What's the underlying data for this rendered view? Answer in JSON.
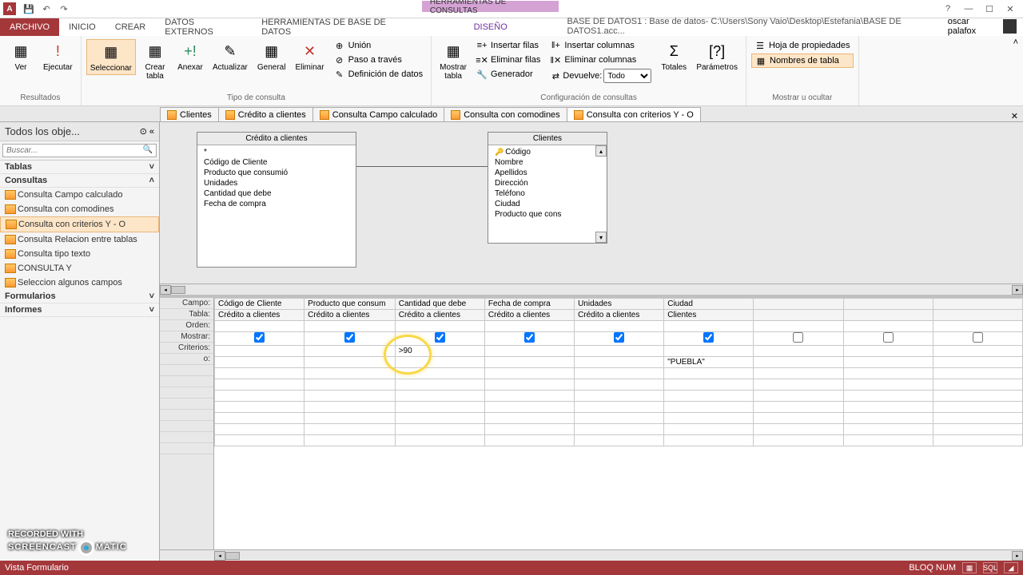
{
  "qat": {
    "save": "💾",
    "undo": "↶",
    "redo": "↷"
  },
  "window": {
    "context_title": "HERRAMIENTAS DE CONSULTAS",
    "app_title": "BASE DE DATOS1 : Base de datos- C:\\Users\\Sony Vaio\\Desktop\\Estefania\\BASE DE DATOS1.acc...",
    "user": "oscar palafox"
  },
  "tabs": {
    "file": "ARCHIVO",
    "list": [
      "INICIO",
      "CREAR",
      "DATOS EXTERNOS",
      "HERRAMIENTAS DE BASE DE DATOS"
    ],
    "design": "DISEÑO"
  },
  "ribbon": {
    "g1_label": "Resultados",
    "ver": "Ver",
    "ejecutar": "Ejecutar",
    "g2_label": "Tipo de consulta",
    "seleccionar": "Seleccionar",
    "crear_tabla": "Crear\ntabla",
    "anexar": "Anexar",
    "actualizar": "Actualizar",
    "general": "General",
    "eliminar": "Eliminar",
    "union": "Unión",
    "paso": "Paso a través",
    "defdatos": "Definición de datos",
    "g3_label": "Configuración de consultas",
    "mostrar_tabla": "Mostrar\ntabla",
    "ins_filas": "Insertar filas",
    "elim_filas": "Eliminar filas",
    "generador": "Generador",
    "ins_cols": "Insertar columnas",
    "elim_cols": "Eliminar columnas",
    "devuelve": "Devuelve:",
    "devuelve_val": "Todo",
    "totales": "Totales",
    "parametros": "Parámetros",
    "g4_label": "Mostrar u ocultar",
    "hoja_prop": "Hoja de propiedades",
    "nombres_tabla": "Nombres de tabla"
  },
  "doctabs": [
    "Clientes",
    "Crédito a clientes",
    "Consulta Campo calculado",
    "Consulta con comodines",
    "Consulta con criterios Y - O"
  ],
  "nav": {
    "title": "Todos los obje...",
    "search_ph": "Buscar...",
    "groups": {
      "tablas": "Tablas",
      "consultas": "Consultas",
      "formularios": "Formularios",
      "informes": "Informes"
    },
    "consultas_items": [
      "Consulta Campo calculado",
      "Consulta con comodines",
      "Consulta con criterios Y - O",
      "Consulta Relacion entre tablas",
      "Consulta tipo texto",
      "CONSULTA Y",
      "Seleccion algunos campos"
    ],
    "selected_index": 2
  },
  "tables": {
    "t1": {
      "title": "Crédito a clientes",
      "fields": [
        "*",
        "Código de Cliente",
        "Producto que consumió",
        "Unidades",
        "Cantidad que debe",
        "Fecha de compra"
      ]
    },
    "t2": {
      "title": "Clientes",
      "fields_key": "Código",
      "fields": [
        "Nombre",
        "Apellidos",
        "Dirección",
        "Teléfono",
        "Ciudad",
        "Producto que cons"
      ]
    }
  },
  "qbe": {
    "labels": [
      "Campo:",
      "Tabla:",
      "Orden:",
      "Mostrar:",
      "Criterios:",
      "o:"
    ],
    "cols": [
      {
        "campo": "Código de Cliente",
        "tabla": "Crédito a clientes",
        "mostrar": true,
        "crit": "",
        "o": ""
      },
      {
        "campo": "Producto que consum",
        "tabla": "Crédito a clientes",
        "mostrar": true,
        "crit": "",
        "o": ""
      },
      {
        "campo": "Cantidad que debe",
        "tabla": "Crédito a clientes",
        "mostrar": true,
        "crit": ">90",
        "o": ""
      },
      {
        "campo": "Fecha de compra",
        "tabla": "Crédito a clientes",
        "mostrar": true,
        "crit": "",
        "o": ""
      },
      {
        "campo": "Unidades",
        "tabla": "Crédito a clientes",
        "mostrar": true,
        "crit": "",
        "o": ""
      },
      {
        "campo": "Ciudad",
        "tabla": "Clientes",
        "mostrar": true,
        "crit": "",
        "o": "\"PUEBLA\""
      },
      {
        "campo": "",
        "tabla": "",
        "mostrar": false,
        "crit": "",
        "o": ""
      },
      {
        "campo": "",
        "tabla": "",
        "mostrar": false,
        "crit": "",
        "o": ""
      },
      {
        "campo": "",
        "tabla": "",
        "mostrar": false,
        "crit": "",
        "o": ""
      }
    ]
  },
  "status": {
    "left": "Vista Formulario",
    "bloq": "BLOQ NUM",
    "sql": "SQL"
  },
  "watermark": {
    "line1": "RECORDED WITH",
    "line2a": "SCREENCAST",
    "line2b": "MATIC"
  }
}
